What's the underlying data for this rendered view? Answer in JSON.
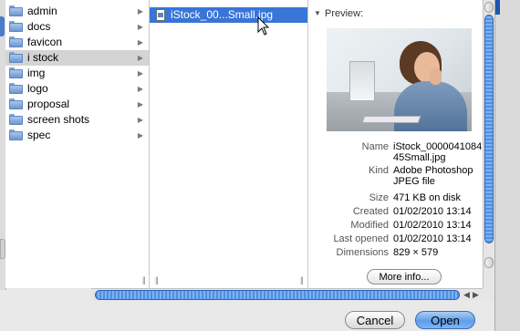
{
  "folders": [
    {
      "label": "admin",
      "selected": false
    },
    {
      "label": "docs",
      "selected": false
    },
    {
      "label": "favicon",
      "selected": false
    },
    {
      "label": "i stock",
      "selected": true
    },
    {
      "label": "img",
      "selected": false
    },
    {
      "label": "logo",
      "selected": false
    },
    {
      "label": "proposal",
      "selected": false
    },
    {
      "label": "screen shots",
      "selected": false
    },
    {
      "label": "spec",
      "selected": false
    }
  ],
  "file": {
    "label": "iStock_00...Small.jpg"
  },
  "preview": {
    "title": "Preview:",
    "info": [
      {
        "key": "Name",
        "value": "iStock_000004108445Small.jpg"
      },
      {
        "key": "Kind",
        "value": "Adobe Photoshop JPEG file"
      },
      {
        "key": "Size",
        "value": "471 KB on disk"
      },
      {
        "key": "Created",
        "value": "01/02/2010 13:14"
      },
      {
        "key": "Modified",
        "value": "01/02/2010 13:14"
      },
      {
        "key": "Last opened",
        "value": "01/02/2010 13:14"
      },
      {
        "key": "Dimensions",
        "value": "829 × 579"
      }
    ],
    "more_info_label": "More info..."
  },
  "buttons": {
    "cancel": "Cancel",
    "open": "Open"
  },
  "colors": {
    "selection": "#3875d7",
    "scroll_thumb": "#4d8fe6",
    "default_button": "#5f9ee8"
  }
}
